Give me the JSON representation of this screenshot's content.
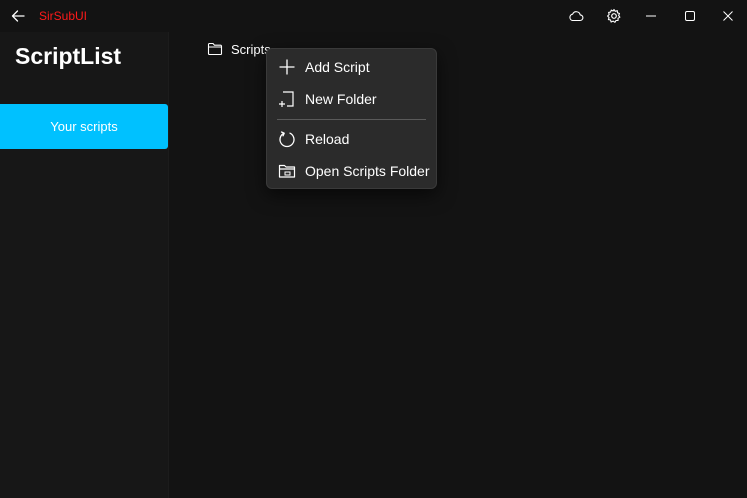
{
  "app": {
    "title": "SirSubUI"
  },
  "titlebar": {
    "icons": [
      "back-arrow-icon",
      "cloud-icon",
      "gear-icon",
      "minimize-icon",
      "maximize-icon",
      "close-icon"
    ]
  },
  "sidebar": {
    "title": "ScriptList",
    "items": [
      {
        "label": "Your scripts",
        "selected": true
      }
    ]
  },
  "main": {
    "folder": {
      "label": "Scripts",
      "icon": "folder-icon"
    }
  },
  "context_menu": {
    "items": [
      {
        "label": "Add Script",
        "icon": "plus-icon"
      },
      {
        "label": "New Folder",
        "icon": "new-folder-icon"
      },
      {
        "label": "Reload",
        "icon": "reload-icon"
      },
      {
        "label": "Open Scripts Folder",
        "icon": "open-folder-icon"
      }
    ]
  },
  "colors": {
    "accent": "#00c1ff",
    "title_red": "#ff1a1a",
    "background": "#131313",
    "menu_bg": "#2b2b2b"
  }
}
